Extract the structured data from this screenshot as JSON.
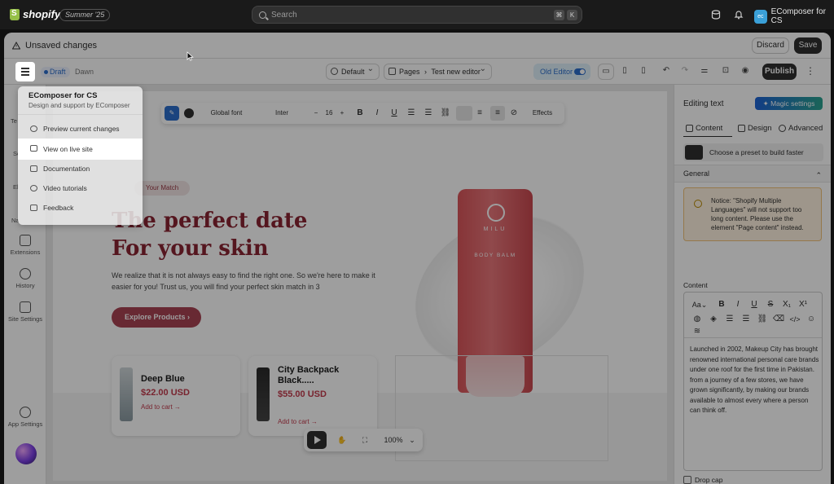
{
  "topbar": {
    "brand": "shopify",
    "edition": "Summer '25",
    "search_placeholder": "Search",
    "shortcut_keys": [
      "⌘",
      "K"
    ],
    "store_initials": "ec",
    "store_name": "EComposer for CS"
  },
  "unsaved_bar": {
    "message": "Unsaved changes",
    "discard_label": "Discard",
    "save_label": "Save"
  },
  "toolbar": {
    "status": "Draft",
    "theme": "Dawn",
    "device_select": "Default",
    "pages_label": "Pages",
    "page_name": "Test new editor",
    "old_editor_label": "Old Editor",
    "publish_label": "Publish"
  },
  "rail": {
    "items": [
      {
        "label": "Extensions",
        "icon": "extensions-icon"
      },
      {
        "label": "History",
        "icon": "history-icon"
      },
      {
        "label": "Site Settings",
        "icon": "site-settings-icon"
      },
      {
        "label": "App Settings",
        "icon": "gear-icon"
      }
    ],
    "partial_labels": [
      "Te",
      "Se",
      "El",
      "Na"
    ]
  },
  "menu": {
    "title": "EComposer for CS",
    "subtitle": "Design and support by EComposer",
    "items": [
      {
        "label": "Preview current changes",
        "icon": "eye-icon"
      },
      {
        "label": "View on live site",
        "icon": "store-icon"
      },
      {
        "label": "Documentation",
        "icon": "document-icon"
      },
      {
        "label": "Video tutorials",
        "icon": "play-circle-icon"
      },
      {
        "label": "Feedback",
        "icon": "feedback-icon"
      }
    ]
  },
  "text_toolbar": {
    "global_font": "Global font",
    "font": "Inter",
    "size": "16",
    "effects": "Effects"
  },
  "canvas": {
    "badge": "Your Match",
    "hero_title_line1": "The perfect date",
    "hero_title_line2": "For your skin",
    "hero_sub": "We realize that it is not always easy to find the right one. So we're here to make it easier for you! Trust us, you will find your perfect skin match in 3",
    "cta": "Explore Products",
    "product_brand": "MILU",
    "product_name": "BODY BALM",
    "cards": [
      {
        "name": "Deep Blue",
        "price": "$22.00 USD",
        "cart": "Add to cart"
      },
      {
        "name": "City Backpack Black.....",
        "price": "$55.00 USD",
        "cart": "Add to cart"
      }
    ]
  },
  "view_tools": {
    "zoom": "100%"
  },
  "panel": {
    "title": "Editing text",
    "magic_label": "Magic settings",
    "tabs": [
      "Content",
      "Design",
      "Advanced"
    ],
    "preset_label": "Choose a preset to build faster",
    "section": "General",
    "notice": "Notice: \"Shopify Multiple Languages\" will not support too long content. Please use the element \"Page content\" instead.",
    "content_label": "Content",
    "content_text": "Launched in 2002, Makeup City has brought renowned international personal care brands under one roof for the first time in Pakistan. from a journey of a few stores, we have grown significantly, by making our brands available to almost every where a person can think off.",
    "drop_cap_label": "Drop cap"
  }
}
